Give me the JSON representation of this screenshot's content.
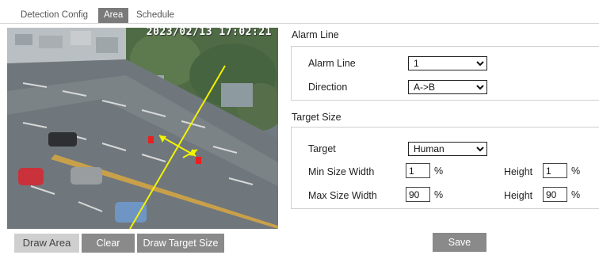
{
  "tabs": [
    {
      "label": "Detection Config",
      "active": false
    },
    {
      "label": "Area",
      "active": true
    },
    {
      "label": "Schedule",
      "active": false
    }
  ],
  "video": {
    "timestamp": "2023/02/13 17:02:21"
  },
  "buttons": {
    "draw_area": "Draw Area",
    "clear": "Clear",
    "draw_target_size": "Draw Target Size",
    "save": "Save"
  },
  "alarm_section": {
    "title": "Alarm Line",
    "alarm_line_label": "Alarm Line",
    "alarm_line_value": "1",
    "direction_label": "Direction",
    "direction_value": "A->B"
  },
  "target_section": {
    "title": "Target Size",
    "target_label": "Target",
    "target_value": "Human",
    "min_width_label": "Min Size Width",
    "min_width_value": "1",
    "min_height_label": "Height",
    "min_height_value": "1",
    "max_width_label": "Max Size Width",
    "max_width_value": "90",
    "max_height_label": "Height",
    "max_height_value": "90",
    "unit": "%"
  },
  "colors": {
    "active_tab": "#7a7a7a",
    "button": "#8a8a8a",
    "button_disabled": "#cfcfcf",
    "alarm_line": "#f2f200",
    "marker": "#e82020"
  }
}
